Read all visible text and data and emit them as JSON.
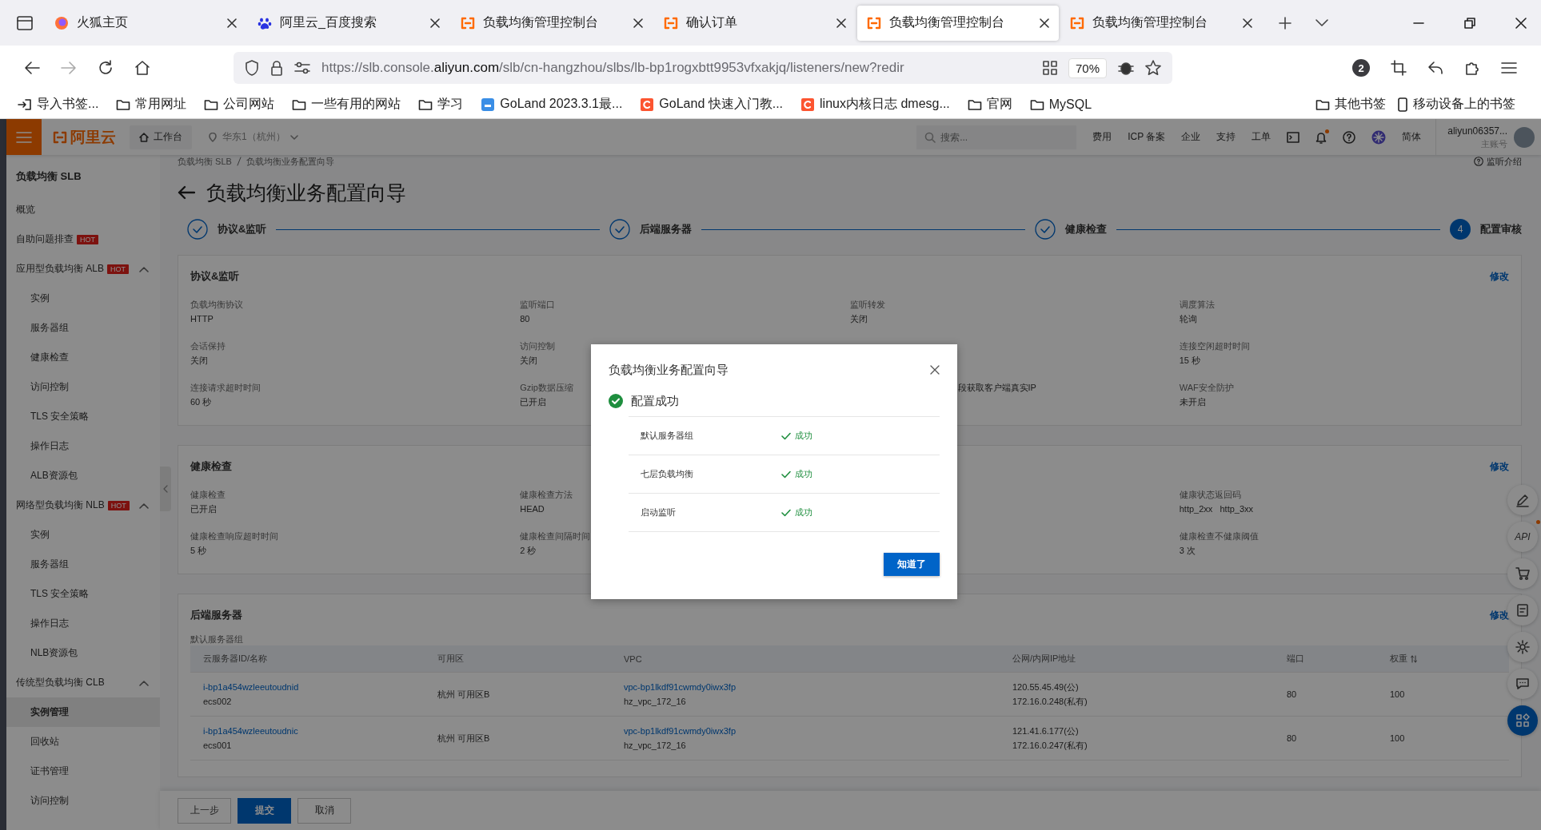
{
  "browser": {
    "tabs": [
      {
        "title": "火狐主页",
        "kind": "firefox",
        "selected": false
      },
      {
        "title": "阿里云_百度搜索",
        "kind": "baidu",
        "selected": false
      },
      {
        "title": "负载均衡管理控制台",
        "kind": "aliyun",
        "selected": false
      },
      {
        "title": "确认订单",
        "kind": "aliyun",
        "selected": false
      },
      {
        "title": "负载均衡管理控制台",
        "kind": "aliyun",
        "selected": true
      },
      {
        "title": "负载均衡管理控制台",
        "kind": "aliyun",
        "selected": false
      }
    ],
    "can_go_forward": false,
    "url": "https://slb.console.**aliyun.com**/slb/cn-hangzhou/slbs/lb-bp1rogxbtt9953vfxakjq/listeners/new?redir",
    "zoom": "70%",
    "account_badge": "2",
    "bookmarks": [
      {
        "label": "导入书签...",
        "kind": "import"
      },
      {
        "label": "常用网址",
        "kind": "folder"
      },
      {
        "label": "公司网站",
        "kind": "folder"
      },
      {
        "label": "一些有用的网站",
        "kind": "folder"
      },
      {
        "label": "学习",
        "kind": "folder"
      },
      {
        "label": "GoLand 2023.3.1最...",
        "kind": "app"
      },
      {
        "label": "GoLand 快速入门教...",
        "kind": "csdn"
      },
      {
        "label": "linux内核日志 dmesg...",
        "kind": "csdn"
      },
      {
        "label": "官网",
        "kind": "folder"
      },
      {
        "label": "MySQL",
        "kind": "folder"
      }
    ],
    "bookmarks_right": [
      {
        "label": "其他书签",
        "kind": "folder"
      },
      {
        "label": "移动设备上的书签",
        "kind": "mobile"
      }
    ]
  },
  "header": {
    "logo": "阿里云",
    "workbench": "工作台",
    "region": "华东1（杭州）",
    "search": {
      "placeholder": "搜索..."
    },
    "links": [
      "费用",
      "ICP 备案",
      "企业",
      "支持",
      "工单"
    ],
    "bell_dot": true,
    "language": "简体",
    "user": {
      "name": "aliyun06357...",
      "role": "主账号"
    }
  },
  "sidebar": {
    "title": "负载均衡 SLB",
    "items": [
      {
        "label": "概览",
        "selected": false
      },
      {
        "label": "自助问题排查",
        "badge": "HOT",
        "selected": false
      },
      {
        "label": "应用型负载均衡 ALB",
        "badge": "HOT",
        "expanded": true,
        "selected": false,
        "children": [
          {
            "label": "实例",
            "selected": false
          },
          {
            "label": "服务器组",
            "selected": false
          },
          {
            "label": "健康检查",
            "selected": false
          },
          {
            "label": "访问控制",
            "selected": false
          },
          {
            "label": "TLS 安全策略",
            "selected": false
          },
          {
            "label": "操作日志",
            "selected": false
          },
          {
            "label": "ALB资源包",
            "selected": false
          }
        ]
      },
      {
        "label": "网络型负载均衡 NLB",
        "badge": "HOT",
        "expanded": true,
        "selected": false,
        "children": [
          {
            "label": "实例",
            "selected": false
          },
          {
            "label": "服务器组",
            "selected": false
          },
          {
            "label": "TLS 安全策略",
            "selected": false
          },
          {
            "label": "操作日志",
            "selected": false
          },
          {
            "label": "NLB资源包",
            "selected": false
          }
        ]
      },
      {
        "label": "传统型负载均衡 CLB",
        "expanded": true,
        "selected": false,
        "children": [
          {
            "label": "实例管理",
            "selected": true
          },
          {
            "label": "回收站",
            "selected": false
          },
          {
            "label": "证书管理",
            "selected": false
          },
          {
            "label": "访问控制",
            "selected": false
          }
        ]
      }
    ]
  },
  "breadcrumb": [
    "负载均衡 SLB",
    "负载均衡业务配置向导"
  ],
  "help_link": "监听介绍",
  "page_title": "负载均衡业务配置向导",
  "steps": [
    {
      "label": "协议&监听",
      "done": true
    },
    {
      "label": "后端服务器",
      "done": true
    },
    {
      "label": "健康检查",
      "done": true
    },
    {
      "label": "配置审核",
      "done": false,
      "number": "4"
    }
  ],
  "sections": [
    {
      "title": "协议&监听",
      "edit": "修改",
      "fields": [
        {
          "label": "负载均衡协议",
          "value": "HTTP"
        },
        {
          "label": "监听端口",
          "value": "80"
        },
        {
          "label": "监听转发",
          "value": "关闭"
        },
        {
          "label": "调度算法",
          "value": "轮询"
        },
        {
          "label": "会话保持",
          "value": "关闭"
        },
        {
          "label": "访问控制",
          "value": "关闭"
        },
        {
          "kind": "covered"
        },
        {
          "label": "连接空闲超时时间",
          "value": "15 秒"
        },
        {
          "label": "连接请求超时时间",
          "value": "60 秒"
        },
        {
          "label": "Gzip数据压缩",
          "value": "已开启"
        },
        {
          "kind": "covered",
          "value": "段获取客户端真实IP"
        },
        {
          "label": "WAF安全防护",
          "value": "未开启"
        }
      ]
    },
    {
      "title": "健康检查",
      "edit": "修改",
      "fields": [
        {
          "label": "健康检查",
          "value": "已开启"
        },
        {
          "label": "健康检查方法",
          "value": "HEAD"
        },
        {
          "kind": "covered"
        },
        {
          "label": "健康状态返回码",
          "value": "http_2xx   http_3xx"
        },
        {
          "label": "健康检查响应超时时间",
          "value": "5 秒"
        },
        {
          "label": "健康检查间隔时间",
          "value": "2 秒"
        },
        {
          "kind": "covered"
        },
        {
          "label": "健康检查不健康阈值",
          "value": "3 次"
        }
      ]
    }
  ],
  "servers": {
    "title": "后端服务器",
    "edit": "修改",
    "group": "默认服务器组",
    "columns": [
      "云服务器ID/名称",
      "可用区",
      "VPC",
      "公网/内网IP地址",
      "端口",
      "权重"
    ],
    "rows": [
      {
        "id": "i-bp1a454wzleeutoudnid",
        "name": "ecs002",
        "zone": "杭州 可用区B",
        "vpc": "vpc-bp1lkdf91cwmdy0iwx3fp",
        "vswitch": "hz_vpc_172_16",
        "public_ip": "120.55.45.49(公)",
        "private_ip": "172.16.0.248(私有)",
        "port": "80",
        "weight": "100"
      },
      {
        "id": "i-bp1a454wzleeutoudnic",
        "name": "ecs001",
        "zone": "杭州 可用区B",
        "vpc": "vpc-bp1lkdf91cwmdy0iwx3fp",
        "vswitch": "hz_vpc_172_16",
        "public_ip": "121.41.6.177(公)",
        "private_ip": "172.16.0.247(私有)",
        "port": "80",
        "weight": "100"
      }
    ]
  },
  "footer_buttons": [
    {
      "label": "上一步",
      "kind": "default"
    },
    {
      "label": "提交",
      "kind": "primary"
    },
    {
      "label": "取消",
      "kind": "default"
    }
  ],
  "float_toolbar": {
    "api": "API",
    "api_dot": true
  },
  "modal": {
    "title": "负载均衡业务配置向导",
    "status": "配置成功",
    "tasks": [
      {
        "name": "默认服务器组",
        "result": "成功",
        "success": true
      },
      {
        "name": "七层负载均衡",
        "result": "成功",
        "success": true
      },
      {
        "name": "启动监听",
        "result": "成功",
        "success": true
      }
    ],
    "button": "知道了"
  }
}
